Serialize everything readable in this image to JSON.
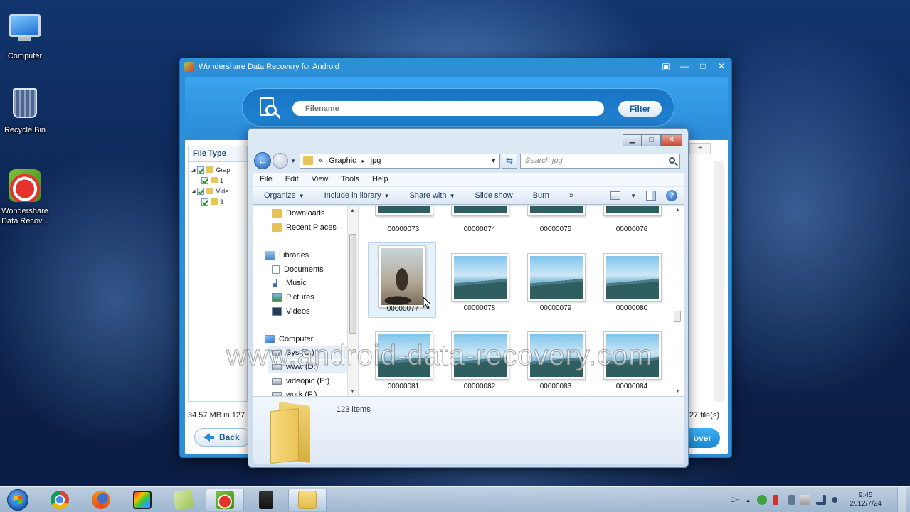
{
  "desktop": {
    "icons": [
      {
        "label": "Computer"
      },
      {
        "label": "Recycle Bin"
      },
      {
        "label": "Wondershare Data Recov..."
      }
    ]
  },
  "recovery_app": {
    "title": "Wondershare Data Recovery for Android",
    "search_placeholder": "Filename",
    "filter_label": "Filter",
    "left_tab": "File Type",
    "tree": [
      {
        "label": "Grap",
        "checked": true
      },
      {
        "label": "1",
        "checked": true
      },
      {
        "label": "Vide",
        "checked": true
      },
      {
        "label": "3",
        "checked": true
      }
    ],
    "status_left": "34.57 MB in 127",
    "status_right": "27 file(s)",
    "back_label": "Back",
    "recover_label": "over"
  },
  "explorer": {
    "breadcrumb": {
      "prefix": "«",
      "parts": [
        "Graphic",
        "jpg"
      ],
      "separator": "▸"
    },
    "search_placeholder": "Search jpg",
    "menu": [
      "File",
      "Edit",
      "View",
      "Tools",
      "Help"
    ],
    "commands": [
      {
        "label": "Organize",
        "dropdown": true
      },
      {
        "label": "Include in library",
        "dropdown": true
      },
      {
        "label": "Share with",
        "dropdown": true
      },
      {
        "label": "Slide show",
        "dropdown": false
      },
      {
        "label": "Burn",
        "dropdown": false
      },
      {
        "label": "»",
        "dropdown": false
      }
    ],
    "nav_items": [
      {
        "label": "Downloads",
        "icon": "folder-icon"
      },
      {
        "label": "Recent Places",
        "icon": "recent-places-icon"
      },
      {
        "label": "Libraries",
        "icon": "library-icon"
      },
      {
        "label": "Documents",
        "icon": "documents-icon"
      },
      {
        "label": "Music",
        "icon": "music-icon"
      },
      {
        "label": "Pictures",
        "icon": "pictures-icon"
      },
      {
        "label": "Videos",
        "icon": "videos-icon"
      },
      {
        "label": "Computer",
        "icon": "computer-icon"
      },
      {
        "label": "Sys (C:)",
        "icon": "drive-icon"
      },
      {
        "label": "www (D:)",
        "icon": "drive-icon"
      },
      {
        "label": "videopic (E:)",
        "icon": "drive-icon"
      },
      {
        "label": "work (F:)",
        "icon": "drive-icon"
      }
    ],
    "files": [
      "00000073",
      "00000074",
      "00000075",
      "00000076",
      "00000077",
      "00000078",
      "00000079",
      "00000080",
      "00000081",
      "00000082",
      "00000083",
      "00000084"
    ],
    "item_count": "123 items"
  },
  "watermark": "www.android-data-recovery.com",
  "taskbar": {
    "apps": [
      "chrome-icon",
      "firefox-icon",
      "media-icon",
      "notepad-icon",
      "wondershare-icon",
      "camera-icon",
      "explorer-folder-icon"
    ],
    "language": "CH",
    "time": "9:45",
    "date": "2012/7/24"
  }
}
